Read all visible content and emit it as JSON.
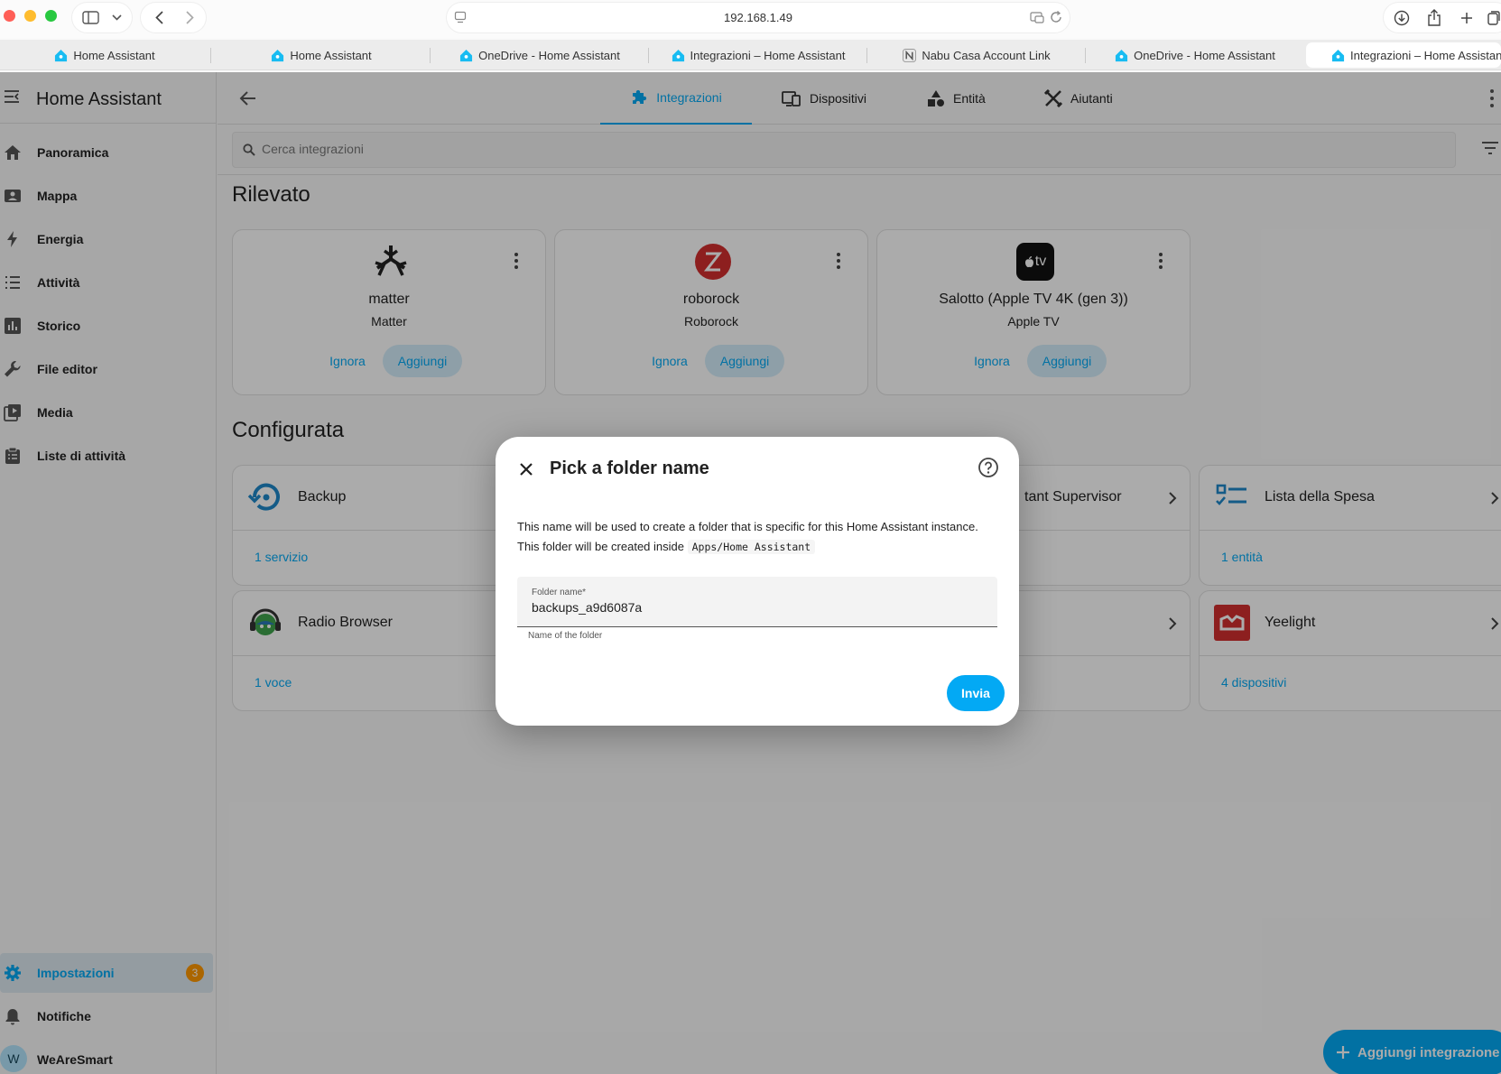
{
  "browser": {
    "url": "192.168.1.49",
    "tabs": [
      {
        "title": "Home Assistant",
        "favicon": "home-assistant-favicon"
      },
      {
        "title": "Home Assistant",
        "favicon": "home-assistant-favicon"
      },
      {
        "title": "OneDrive - Home Assistant",
        "favicon": "home-assistant-favicon"
      },
      {
        "title": "Integrazioni – Home Assistant",
        "favicon": "home-assistant-favicon"
      },
      {
        "title": "Nabu Casa Account Link",
        "favicon": "nabu-casa-favicon"
      },
      {
        "title": "OneDrive - Home Assistant",
        "favicon": "home-assistant-favicon"
      },
      {
        "title": "Integrazioni – Home Assistant",
        "favicon": "home-assistant-favicon"
      }
    ],
    "active_tab": 6
  },
  "sidebar": {
    "title": "Home Assistant",
    "items": [
      {
        "label": "Panoramica",
        "icon": "home-icon"
      },
      {
        "label": "Mappa",
        "icon": "map-icon"
      },
      {
        "label": "Energia",
        "icon": "lightning-icon"
      },
      {
        "label": "Attività",
        "icon": "list-icon"
      },
      {
        "label": "Storico",
        "icon": "chart-icon"
      },
      {
        "label": "File editor",
        "icon": "wrench-icon"
      },
      {
        "label": "Media",
        "icon": "media-icon"
      },
      {
        "label": "Liste di attività",
        "icon": "clipboard-icon"
      }
    ],
    "settings": {
      "label": "Impostazioni",
      "badge": "3"
    },
    "notifications": {
      "label": "Notifiche"
    },
    "user": {
      "initial": "W",
      "name": "WeAreSmart"
    }
  },
  "header": {
    "tabs": [
      {
        "label": "Integrazioni",
        "icon": "puzzle-icon"
      },
      {
        "label": "Dispositivi",
        "icon": "devices-icon"
      },
      {
        "label": "Entità",
        "icon": "shapes-icon"
      },
      {
        "label": "Aiutanti",
        "icon": "tools-icon"
      }
    ],
    "active_tab": 0
  },
  "search": {
    "placeholder": "Cerca integrazioni"
  },
  "discovered": {
    "title": "Rilevato",
    "ignore_label": "Ignora",
    "add_label": "Aggiungi",
    "cards": [
      {
        "name": "matter",
        "subtitle": "Matter"
      },
      {
        "name": "roborock",
        "subtitle": "Roborock"
      },
      {
        "name": "Salotto (Apple TV 4K (gen 3))",
        "subtitle": "Apple TV",
        "logo_text": "tv"
      }
    ]
  },
  "configured": {
    "title": "Configurata",
    "cards": [
      {
        "name": "Backup",
        "link": "1 servizio"
      },
      {
        "name": "tant Supervisor",
        "link": ""
      },
      {
        "name": "Lista della Spesa",
        "link": "1 entità"
      },
      {
        "name": "Radio Browser",
        "link": "1 voce"
      },
      {
        "name": "",
        "link": ""
      },
      {
        "name": "Yeelight",
        "link": "4 dispositivi"
      }
    ]
  },
  "fab": {
    "label": "Aggiungi integrazione"
  },
  "dialog": {
    "title": "Pick a folder name",
    "description": "This name will be used to create a folder that is specific for this Home Assistant instance. This folder will be created inside",
    "path": "Apps/Home Assistant",
    "field_label": "Folder name*",
    "field_value": "backups_a9d6087a",
    "helper": "Name of the folder",
    "submit": "Invia"
  },
  "colors": {
    "accent": "#03a9f4",
    "badge": "#ff9800",
    "roborock": "#d32f2f",
    "yeelight": "#d32f2f"
  }
}
